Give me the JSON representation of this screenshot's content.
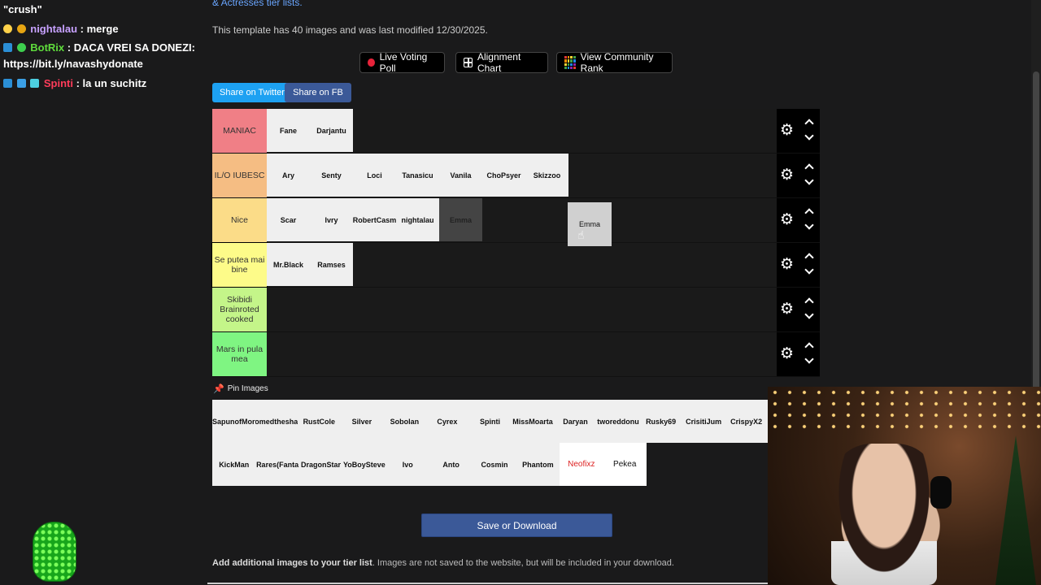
{
  "chat": {
    "line1": "\"crush\"",
    "msg2_user": "nightalau",
    "msg2_text": " : merge",
    "msg3_user": "BotRix",
    "msg3_text": " : DACA VREI SA DONEZI:",
    "msg3_text2": "https://bit.ly/navashydonate",
    "msg4_user": "Spinti",
    "msg4_text": " : la un suchitz"
  },
  "page": {
    "link_text": "& Actresses tier lists.",
    "info": "This template has 40 images and was last modified 12/30/2025."
  },
  "toolbar": {
    "live_poll": "Live Voting Poll",
    "alignment": "Alignment Chart",
    "community": "View Community Rank"
  },
  "share": {
    "twitter": "Share on Twitter",
    "fb": "Share on FB"
  },
  "tiers": [
    {
      "label": "MANIAC",
      "color": "#f07f86",
      "items": [
        "Fane",
        "Darjantu"
      ]
    },
    {
      "label": "IL/O IUBESC",
      "color": "#f5bd83",
      "items": [
        "Ary",
        "Senty",
        "Loci",
        "Tanasicu",
        "Vanila",
        "ChoPsyer",
        "Skizzoo"
      ]
    },
    {
      "label": "Nice",
      "color": "#fbdc88",
      "items": [
        "Scar",
        "Ivry",
        "RobertCasm",
        "nightalau",
        "Emma"
      ]
    },
    {
      "label": "Se putea mai bine",
      "color": "#fdfb89",
      "items": [
        "Mr.Black",
        "Ramses"
      ]
    },
    {
      "label": "Skibidi Brainroted cooked",
      "color": "#c4f589",
      "items": []
    },
    {
      "label": "Mars in pula mea",
      "color": "#7ff582",
      "items": []
    }
  ],
  "dragging": {
    "label": "Emma"
  },
  "pin_images": {
    "label": "Pin Images",
    "row1": [
      "SapunofMor",
      "omedthesha",
      "RustCole",
      "Silver",
      "Sobolan",
      "Cyrex",
      "Spinti",
      "MissMoarta",
      "Daryan",
      "tworeddonu",
      "Rusky69",
      "CrisitiJum",
      "CrispyX2"
    ],
    "row2": [
      "KickMan",
      "Rares(Fanta",
      "DragonStar",
      "YoBoySteve",
      "Ivo",
      "Anto",
      "Cosmin",
      "Phantom",
      "Neofixz",
      "Pekea"
    ]
  },
  "save_button": "Save or Download",
  "add_text_bold": "Add additional images to your tier list",
  "add_text_rest": ". Images are not saved to the website, but will be included in your download.",
  "colors": {
    "twitter": "#1da1f2",
    "fb": "#3b5998",
    "save": "#3b5998",
    "live_dot": "#e8233a"
  }
}
